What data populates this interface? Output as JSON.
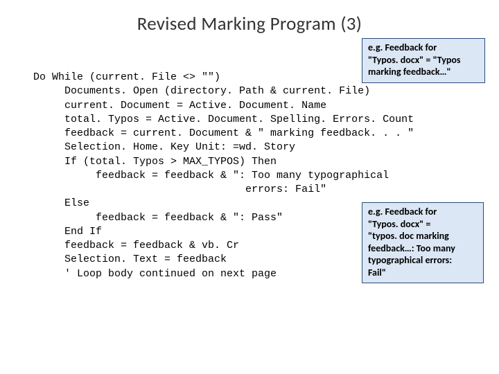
{
  "title": "Revised Marking Program (3)",
  "code": "Do While (current. File <> \"\")\n     Documents. Open (directory. Path & current. File)\n     current. Document = Active. Document. Name\n     total. Typos = Active. Document. Spelling. Errors. Count\n     feedback = current. Document & \" marking feedback. . . \"\n     Selection. Home. Key Unit: =wd. Story\n     If (total. Typos > MAX_TYPOS) Then\n          feedback = feedback & \": Too many typographical\n                                  errors: Fail\"\n     Else\n          feedback = feedback & \": Pass\"\n     End If\n     feedback = feedback & vb. Cr\n     Selection. Text = feedback\n     ' Loop body continued on next page",
  "annot1": {
    "line1": "e.g. Feedback for",
    "line2": "\"Typos. docx\" = \"Typos",
    "line3": "marking feedback…\""
  },
  "annot2": {
    "line1": "e.g. Feedback for",
    "line2": "\"Typos. docx\" =",
    "line3": "\"typos. doc marking",
    "line4": "feedback…: Too many",
    "line5": "typographical errors:",
    "line6": "Fail\""
  }
}
